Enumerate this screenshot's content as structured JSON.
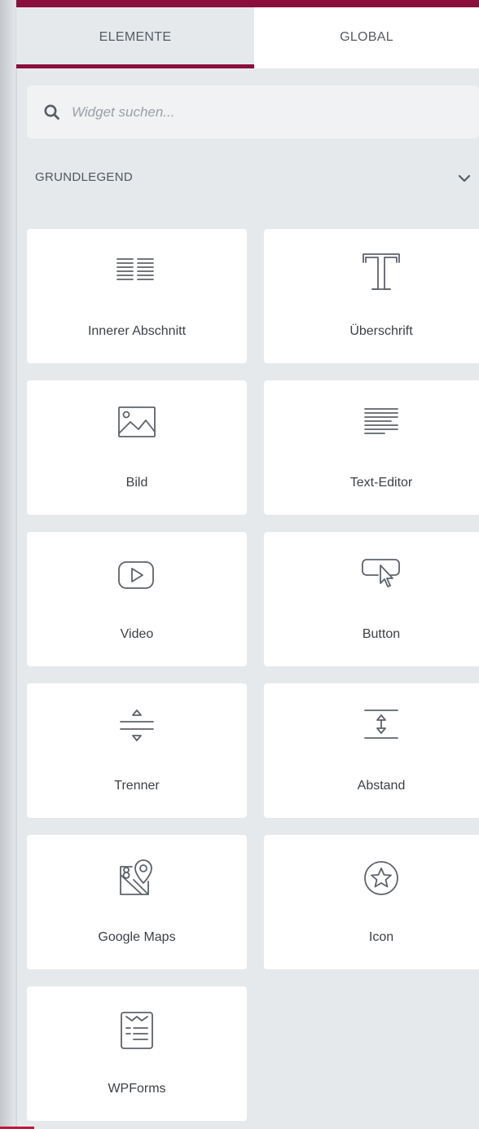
{
  "tabs": {
    "elements_label": "ELEMENTE",
    "global_label": "GLOBAL",
    "active": "ELEMENTE"
  },
  "search": {
    "placeholder": "Widget suchen..."
  },
  "section": {
    "title": "GRUNDLEGEND",
    "expanded": true
  },
  "widgets": [
    {
      "label": "Innerer Abschnitt",
      "icon": "inner-section-icon"
    },
    {
      "label": "Überschrift",
      "icon": "heading-icon"
    },
    {
      "label": "Bild",
      "icon": "image-icon"
    },
    {
      "label": "Text-Editor",
      "icon": "text-editor-icon"
    },
    {
      "label": "Video",
      "icon": "video-icon"
    },
    {
      "label": "Button",
      "icon": "button-icon"
    },
    {
      "label": "Trenner",
      "icon": "divider-icon"
    },
    {
      "label": "Abstand",
      "icon": "spacer-icon"
    },
    {
      "label": "Google Maps",
      "icon": "google-maps-icon"
    },
    {
      "label": "Icon",
      "icon": "star-icon"
    },
    {
      "label": "WPForms",
      "icon": "wpforms-icon"
    }
  ],
  "colors": {
    "accent": "#8a0f3d",
    "panel_background": "#e6e9ec",
    "card_background": "#ffffff",
    "icon_stroke": "#5e636a",
    "text": "#3c4146"
  }
}
